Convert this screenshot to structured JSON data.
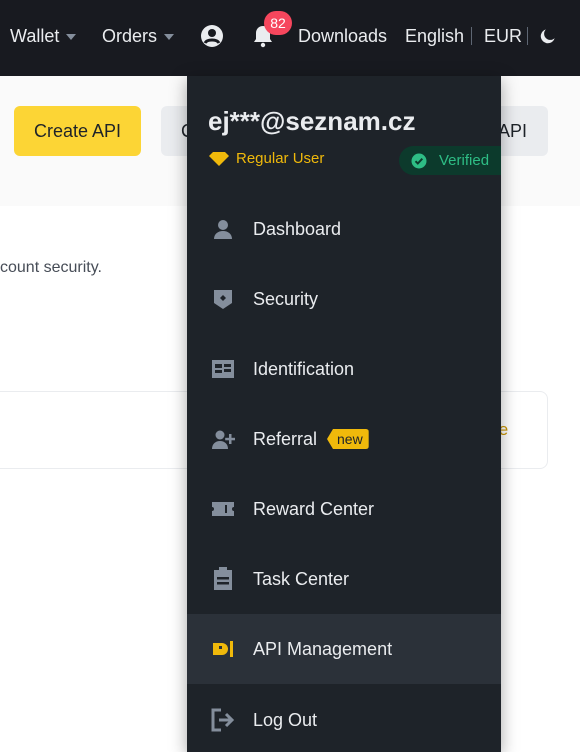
{
  "topbar": {
    "wallet_label": "Wallet",
    "orders_label": "Orders",
    "notification_count": "82",
    "downloads_label": "Downloads",
    "language_label": "English",
    "currency_label": "EUR"
  },
  "page": {
    "create_api_label": "Create API",
    "grey_button_1_label": "C",
    "grey_button_2_label": "API",
    "security_text": "count security.",
    "card_link_text": "te"
  },
  "dropdown": {
    "email": "ej***@seznam.cz",
    "user_level": "Regular User",
    "verified_label": "Verified",
    "items": [
      {
        "label": "Dashboard",
        "icon": "person-icon"
      },
      {
        "label": "Security",
        "icon": "shield-icon"
      },
      {
        "label": "Identification",
        "icon": "id-card-icon"
      },
      {
        "label": "Referral",
        "icon": "add-person-icon",
        "tag": "new"
      },
      {
        "label": "Reward Center",
        "icon": "ticket-icon"
      },
      {
        "label": "Task Center",
        "icon": "clipboard-icon"
      },
      {
        "label": "API Management",
        "icon": "api-plug-icon",
        "active": true
      },
      {
        "label": "Log Out",
        "icon": "logout-icon"
      }
    ]
  },
  "colors": {
    "accent": "#f0b90b",
    "verified_green": "#2ebd85",
    "badge_red": "#f6465d"
  }
}
